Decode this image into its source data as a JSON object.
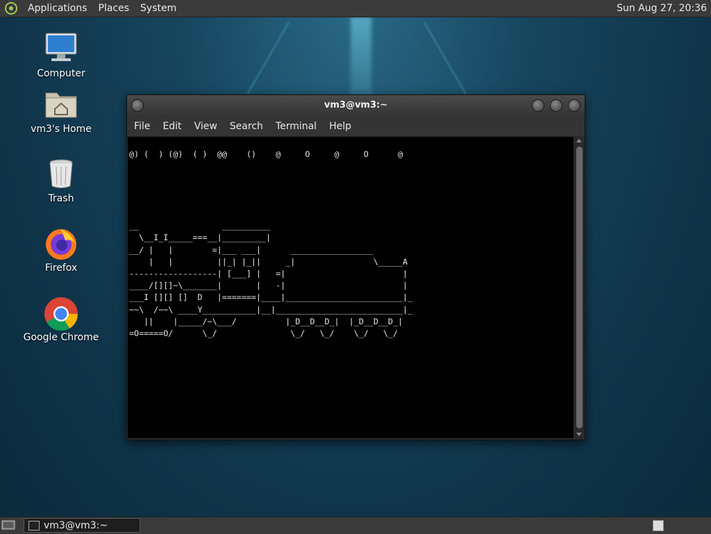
{
  "top_panel": {
    "menus": [
      "Applications",
      "Places",
      "System"
    ],
    "clock": "Sun Aug 27, 20:36"
  },
  "desktop_icons": [
    {
      "label": "Computer",
      "icon": "computer-icon"
    },
    {
      "label": "vm3's Home",
      "icon": "home-folder-icon"
    },
    {
      "label": "Trash",
      "icon": "trash-icon"
    },
    {
      "label": "Firefox",
      "icon": "firefox-icon"
    },
    {
      "label": "Google Chrome",
      "icon": "chrome-icon"
    }
  ],
  "window": {
    "title": "vm3@vm3:~",
    "menu": [
      "File",
      "Edit",
      "View",
      "Search",
      "Terminal",
      "Help"
    ],
    "terminal_text": "@) (  ) (@)  ( )  @@    ()    @     O     @     O      @\n\n\n\n\n\n__                 __________\n  \\__I_I_____===__|_________|\n__/ |   |        =|___ ___|      _________________\n    |   |         ||_| |_||     _|                \\_____A\n------------------| [___] |   =|                        |\n____/[][]~\\_______|       |   -|                        |\n___I [][] []  D   |=======|____|________________________|_\n~~\\  /~~\\ ____Y___________|__|__________________________|_\n   ||    |_____/~\\___/          |_D__D__D_|  |_D__D__D_|\n=O=====O/      \\_/               \\_/   \\_/    \\_/   \\_/"
  },
  "bottom_panel": {
    "task_label": "vm3@vm3:~"
  }
}
